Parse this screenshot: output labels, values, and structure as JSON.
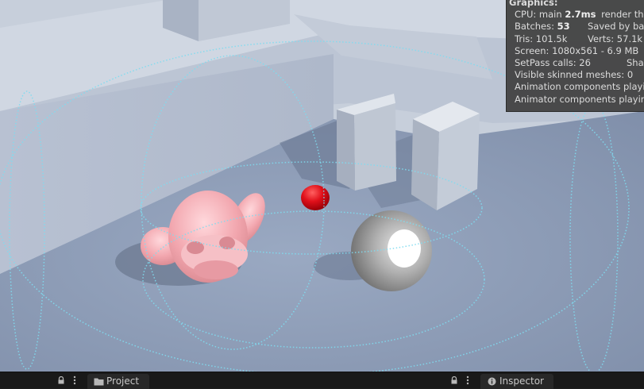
{
  "stats": {
    "header": "Graphics:",
    "cpu_label": "CPU: main",
    "cpu_value": "2.7ms",
    "render_thread_label": "render threa",
    "batches_label": "Batches:",
    "batches_value": "53",
    "saved_by_batching_label": "Saved by bat",
    "tris_text": "Tris: 101.5k",
    "verts_text": "Verts: 57.1k",
    "screen_text": "Screen: 1080x561 - 6.9 MB",
    "setpass_text": "SetPass calls: 26",
    "shadow_casters_label": "Shad",
    "visible_skinned_text": "Visible skinned meshes: 0",
    "animation_components_text": "Animation components playin",
    "animator_components_text": "Animator components playing"
  },
  "bottom_bar": {
    "tab_project_label": "Project",
    "tab_inspector_label": "Inspector"
  },
  "scene": {
    "ground_color": "#8e9db8",
    "wall_color": "#c8d0dc",
    "sphere_red_color": "#e0101a",
    "gizmo_color": "#7fdcf0",
    "monkey_color": "#f0a8b0"
  }
}
